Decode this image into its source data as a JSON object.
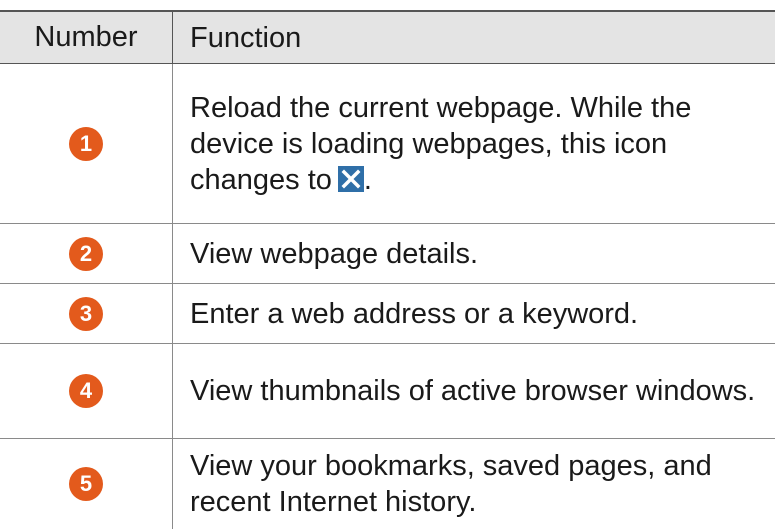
{
  "table": {
    "headers": {
      "number": "Number",
      "function": "Function"
    },
    "rows": [
      {
        "number": "1",
        "function_before_icon": "Reload the current webpage. While the device is loading webpages, this icon changes to",
        "icon": "close-x-icon",
        "function_after_icon": "."
      },
      {
        "number": "2",
        "function": "View webpage details."
      },
      {
        "number": "3",
        "function": "Enter a web address or a keyword."
      },
      {
        "number": "4",
        "function": "View thumbnails of active browser windows."
      },
      {
        "number": "5",
        "function": "View your bookmarks, saved pages, and recent Internet history."
      }
    ]
  },
  "colors": {
    "badge": "#e35a1c",
    "header_background": "#e4e4e4",
    "icon_background": "#2f6fa8"
  }
}
